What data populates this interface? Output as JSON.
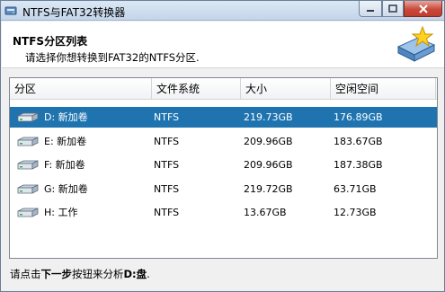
{
  "window": {
    "title": "NTFS与FAT32转换器"
  },
  "header": {
    "title": "NTFS分区列表",
    "subtitle": "请选择你想转换到FAT32的NTFS分区."
  },
  "columns": [
    "分区",
    "文件系统",
    "大小",
    "空闲空间"
  ],
  "partitions": [
    {
      "name": "D: 新加卷",
      "fs": "NTFS",
      "size": "219.73GB",
      "free": "176.89GB",
      "selected": true
    },
    {
      "name": "E: 新加卷",
      "fs": "NTFS",
      "size": "209.96GB",
      "free": "183.67GB",
      "selected": false
    },
    {
      "name": "F: 新加卷",
      "fs": "NTFS",
      "size": "209.96GB",
      "free": "187.38GB",
      "selected": false
    },
    {
      "name": "G: 新加卷",
      "fs": "NTFS",
      "size": "219.72GB",
      "free": "63.71GB",
      "selected": false
    },
    {
      "name": "H: 工作",
      "fs": "NTFS",
      "size": "13.67GB",
      "free": "12.73GB",
      "selected": false
    }
  ],
  "footer": {
    "prefix": "请点击",
    "button_ref": "下一步",
    "middle": "按钮来分析",
    "drive": "D:盘",
    "suffix": "."
  },
  "colors": {
    "selection": "#1f74b0",
    "close_button": "#c84a3c"
  },
  "icons": {
    "app": "converter-icon",
    "header": "disk-star-icon",
    "drive": "hard-drive-icon"
  }
}
